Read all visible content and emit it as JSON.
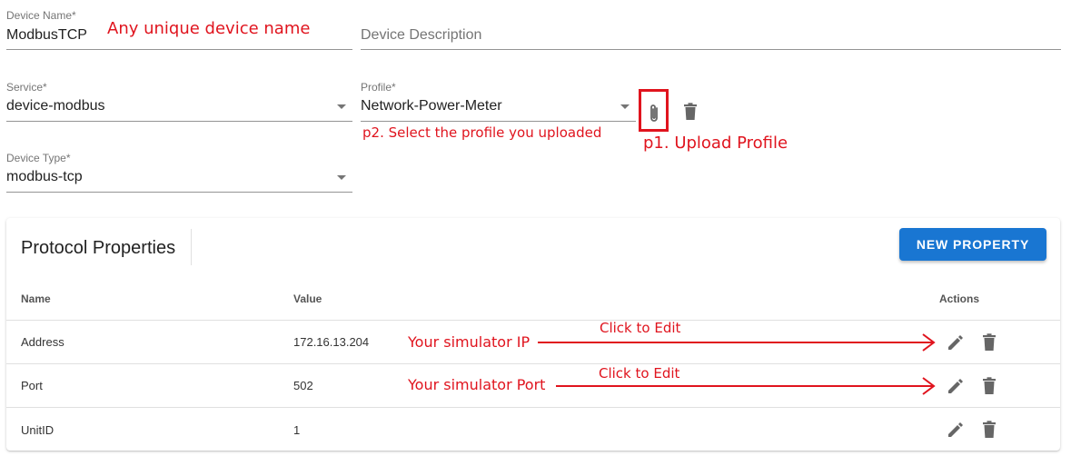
{
  "form": {
    "device_name": {
      "label": "Device Name*",
      "value": "ModbusTCP"
    },
    "device_description": {
      "placeholder": "Device Description"
    },
    "service": {
      "label": "Service*",
      "value": "device-modbus"
    },
    "profile": {
      "label": "Profile*",
      "value": "Network-Power-Meter"
    },
    "device_type": {
      "label": "Device Type*",
      "value": "modbus-tcp"
    }
  },
  "protocol": {
    "title": "Protocol Properties",
    "new_button": "NEW PROPERTY",
    "columns": {
      "name": "Name",
      "value": "Value",
      "actions": "Actions"
    },
    "rows": [
      {
        "name": "Address",
        "value": "172.16.13.204"
      },
      {
        "name": "Port",
        "value": "502"
      },
      {
        "name": "UnitID",
        "value": "1"
      }
    ]
  },
  "annotations": {
    "device_name_note": "Any unique device name",
    "select_profile": "p2. Select the profile you uploaded",
    "upload_profile": "p1. Upload Profile",
    "simulator_ip": "Your simulator IP",
    "simulator_port": "Your simulator Port",
    "click_edit_1": "Click to Edit",
    "click_edit_2": "Click to Edit"
  },
  "colors": {
    "primary": "#1976d2",
    "annotation_red": "#e0141e",
    "icon_grey": "#666666"
  },
  "icons": [
    "paperclip-icon",
    "trash-icon",
    "pencil-icon",
    "dropdown-caret-icon"
  ]
}
